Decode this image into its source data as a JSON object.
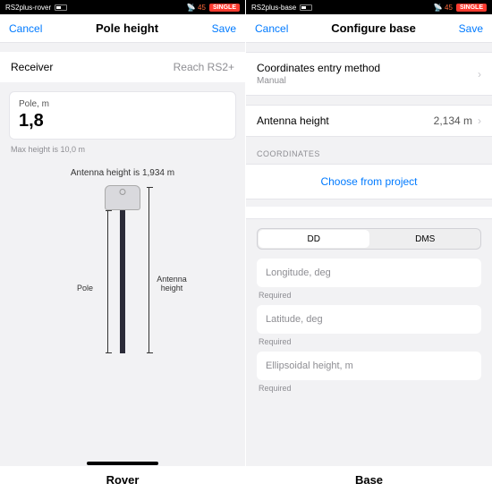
{
  "rover": {
    "status": {
      "device": "RS2plus-rover",
      "sat": "45",
      "badge": "SINGLE"
    },
    "nav": {
      "cancel": "Cancel",
      "title": "Pole height",
      "save": "Save"
    },
    "receiver_label": "Receiver",
    "receiver_value": "Reach RS2+",
    "pole_field_label": "Pole, m",
    "pole_value": "1,8",
    "max_hint": "Max height is 10,0 m",
    "diagram_caption": "Antenna height is 1,934 m",
    "label_pole": "Pole",
    "label_antenna": "Antenna height",
    "footer": "Rover"
  },
  "base": {
    "status": {
      "device": "RS2plus-base",
      "sat": "45",
      "badge": "SINGLE"
    },
    "nav": {
      "cancel": "Cancel",
      "title": "Configure base",
      "save": "Save"
    },
    "coord_method_label": "Coordinates entry method",
    "coord_method_value": "Manual",
    "antenna_label": "Antenna height",
    "antenna_value": "2,134 m",
    "coord_header": "COORDINATES",
    "choose": "Choose from project",
    "seg_dd": "DD",
    "seg_dms": "DMS",
    "fields": {
      "lon": "Longitude, deg",
      "lat": "Latitude, deg",
      "ell": "Ellipsoidal height, m"
    },
    "required": "Required",
    "footer": "Base"
  }
}
